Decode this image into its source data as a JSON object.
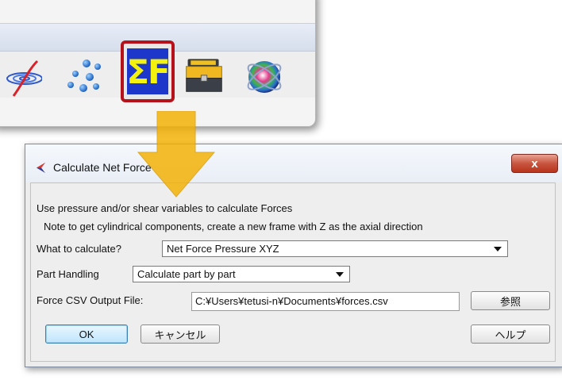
{
  "toolbar": {
    "icons": [
      "orbit-icon",
      "scatter-dots-icon",
      "sigma-force-icon",
      "toolbox-icon",
      "color-sphere-icon"
    ],
    "sigma_label": "ΣF",
    "highlight_color": "#b5121b"
  },
  "dialog": {
    "title": "Calculate Net Force",
    "close_glyph": "x",
    "description": "Use pressure and/or shear variables to calculate Forces",
    "note": "Note to get cylindrical components, create a new frame with Z as the axial direction",
    "what_label": "What to calculate?",
    "what_value": "Net Force Pressure XYZ",
    "part_label": "Part Handling",
    "part_value": "Calculate part by part",
    "csv_label": "Force CSV Output File:",
    "csv_value": "C:¥Users¥tetusi-n¥Documents¥forces.csv",
    "browse_label": "参照",
    "ok_label": "OK",
    "cancel_label": "キャンセル",
    "help_label": "ヘルプ"
  },
  "colors": {
    "arrow": "#f3b000",
    "sigma_bg": "#1c37c9",
    "sigma_fg": "#f2f20e",
    "close_button": "#c8553f"
  }
}
